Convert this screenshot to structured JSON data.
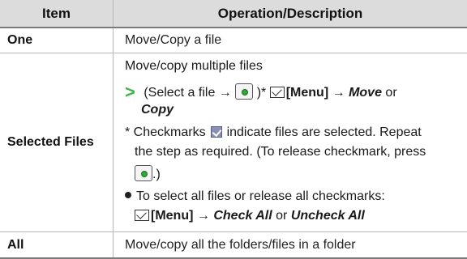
{
  "table": {
    "header": {
      "item": "Item",
      "operation": "Operation/Description"
    },
    "rows": {
      "one": {
        "item": "One",
        "description": "Move/Copy a file"
      },
      "selected": {
        "item": "Selected Files",
        "intro": "Move/copy multiple files",
        "step": {
          "open": "(Select a file →",
          "close": ")*",
          "menu": "[Menu]",
          "arrow": "→",
          "move": "Move",
          "or": "or",
          "copy": "Copy"
        },
        "note": {
          "prefix": "* Checkmarks",
          "text1": "indicate files are selected. Repeat",
          "text2": "the step as required. (To release checkmark, press",
          "close": ".)"
        },
        "bullet": {
          "text": "To select all files or release all checkmarks:",
          "menu": "[Menu]",
          "arrow": "→",
          "check_all": "Check All",
          "or": "or",
          "uncheck_all": "Uncheck All"
        }
      },
      "all": {
        "item": "All",
        "description": "Move/copy all the folders/files in a folder"
      }
    }
  },
  "icons": {
    "step_arrow": "right-chevron-icon",
    "center_key": "center-key-icon",
    "mail_key": "mail-key-icon",
    "checkmark": "checkmark-icon",
    "bullet": "bullet-dot-icon"
  },
  "colors": {
    "step_arrow": "#41b648",
    "header_bg": "#dcdcdc"
  }
}
